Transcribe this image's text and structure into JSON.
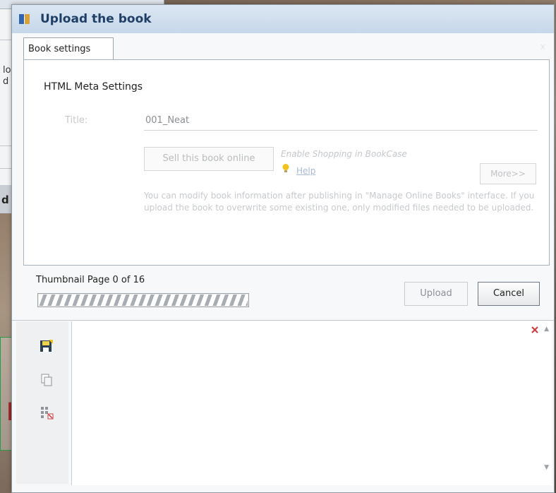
{
  "background": {
    "left_text_lines": [
      "lo",
      "d"
    ],
    "band_label": "d",
    "overlay_text": "ng"
  },
  "dialog": {
    "title": "Upload the book",
    "close_label": "x",
    "tab_label": "Book settings",
    "section_title": "HTML Meta Settings",
    "title_label": "Title:",
    "title_value": "001_Neat",
    "sell_button": "Sell this book online",
    "shopping_note": "Enable Shopping in BookCase",
    "help_link": "Help",
    "more_button": "More>>",
    "info_text": "You can modify book information after publishing in \"Manage Online Books\" interface. If you upload the book to overwrite some existing one, only modified files needed to be uploaded.",
    "thumbnail_status": "Thumbnail Page 0 of 16",
    "progress_fraction": 1.0,
    "upload_button": "Upload",
    "cancel_button": "Cancel"
  },
  "icons": [
    "book-app-icon",
    "lightbulb-icon",
    "save-icon",
    "copy-icon",
    "grid-delete-icon",
    "clear-icon",
    "scroll-up-icon",
    "scroll-down-icon"
  ],
  "colors": {
    "title_text": "#1f3f66",
    "help_link": "#a8b8d8",
    "overlay_text": "#9b2a2a",
    "overlay_border": "#2a9a4a"
  }
}
